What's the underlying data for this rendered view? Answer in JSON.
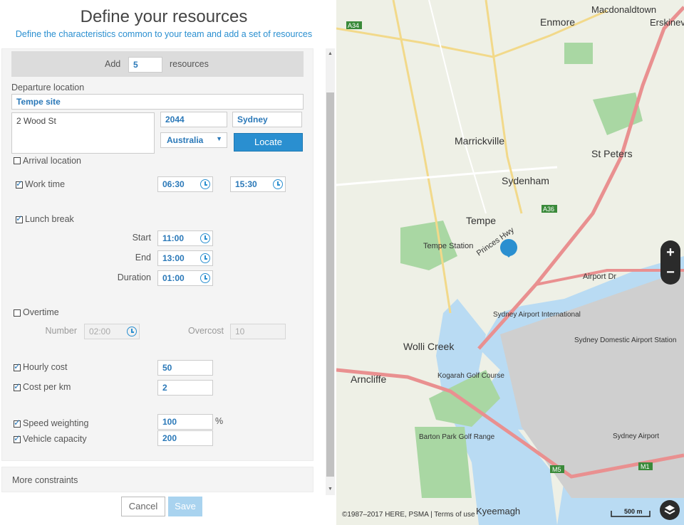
{
  "header": {
    "title": "Define your resources",
    "subtitle": "Define the characteristics common to your team and add a set of resources"
  },
  "resources": {
    "add_label": "Add",
    "count": "5",
    "suffix": "resources"
  },
  "departure": {
    "section_label": "Departure location",
    "site_name": "Tempe site",
    "street": "2 Wood St",
    "postcode": "2044",
    "city": "Sydney",
    "country": "Australia",
    "locate_label": "Locate"
  },
  "arrival": {
    "label": "Arrival location",
    "checked": false
  },
  "work_time": {
    "label": "Work time",
    "checked": true,
    "start": "06:30",
    "end": "15:30"
  },
  "lunch": {
    "label": "Lunch break",
    "checked": true,
    "start_label": "Start",
    "start": "11:00",
    "end_label": "End",
    "end": "13:00",
    "duration_label": "Duration",
    "duration": "01:00"
  },
  "overtime": {
    "label": "Overtime",
    "checked": false,
    "number_label": "Number",
    "number": "02:00",
    "overcost_label": "Overcost",
    "overcost": "10"
  },
  "costs": {
    "hourly_label": "Hourly cost",
    "hourly": "50",
    "per_km_label": "Cost per km",
    "per_km": "2"
  },
  "weighting": {
    "speed_label": "Speed weighting",
    "speed": "100",
    "speed_unit": "%",
    "capacity_label": "Vehicle capacity",
    "capacity": "200"
  },
  "more_constraints": "More constraints",
  "actions": {
    "cancel": "Cancel",
    "save": "Save"
  },
  "map": {
    "labels": {
      "macdonaldtown": "Macdonaldtown",
      "enmore": "Enmore",
      "erskineville": "Erskinevi",
      "marrickville": "Marrickville",
      "sydenham": "Sydenham",
      "st_peters": "St Peters",
      "tempe": "Tempe",
      "tempe_station": "Tempe Station",
      "wolli_creek": "Wolli Creek",
      "arncliffe": "Arncliffe",
      "sydney_airport": "Sydney Airport",
      "sydney_airport_international": "Sydney Airport International",
      "sydney_domestic": "Sydney Domestic Airport Station",
      "kogarah_golf": "Kogarah Golf Course",
      "barton_park": "Barton Park Golf Range",
      "kyeemagh": "Kyeemagh",
      "princes_hwy": "Princes Hwy",
      "airport_dr": "Airport Dr",
      "m5": "M5",
      "m1": "M1",
      "a36": "A36",
      "a34": "A34"
    },
    "scale": "500 m",
    "copyright": "©1987–2017 HERE, PSMA | Terms of use",
    "accent": "#2a8fd0",
    "marker_color": "#2a8fd0"
  }
}
